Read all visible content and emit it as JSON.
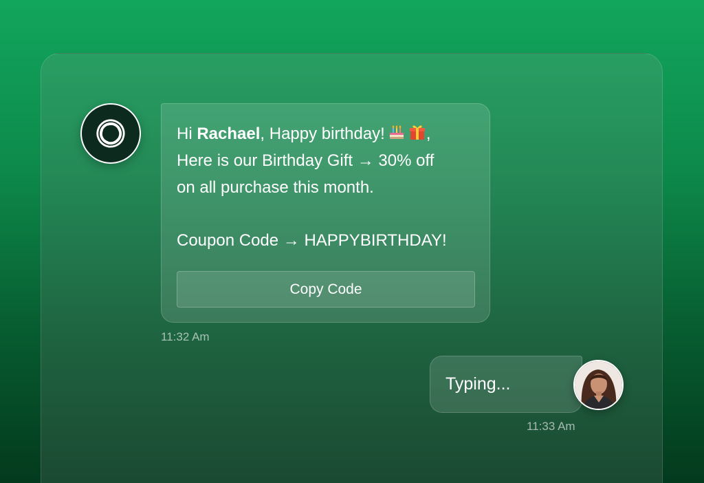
{
  "bot_message": {
    "greeting_prefix": "Hi ",
    "name": "Rachael",
    "greeting_suffix": ", Happy birthday!",
    "emojis": [
      "birthday-cake-icon",
      "gift-icon"
    ],
    "trailing_comma": ",",
    "line2": "Here is our Birthday Gift → 30% off",
    "line3": "on all purchase this month.",
    "coupon_line": "Coupon Code → HAPPYBIRTHDAY!",
    "copy_button_label": "Copy Code",
    "timestamp": "11:32 Am"
  },
  "user_message": {
    "text": "Typing...",
    "timestamp": "11:33 Am"
  },
  "colors": {
    "background_top": "#12a65c",
    "background_bottom": "#033a1d",
    "bot_avatar_bg": "#0d2a1f",
    "text": "#ffffff"
  }
}
